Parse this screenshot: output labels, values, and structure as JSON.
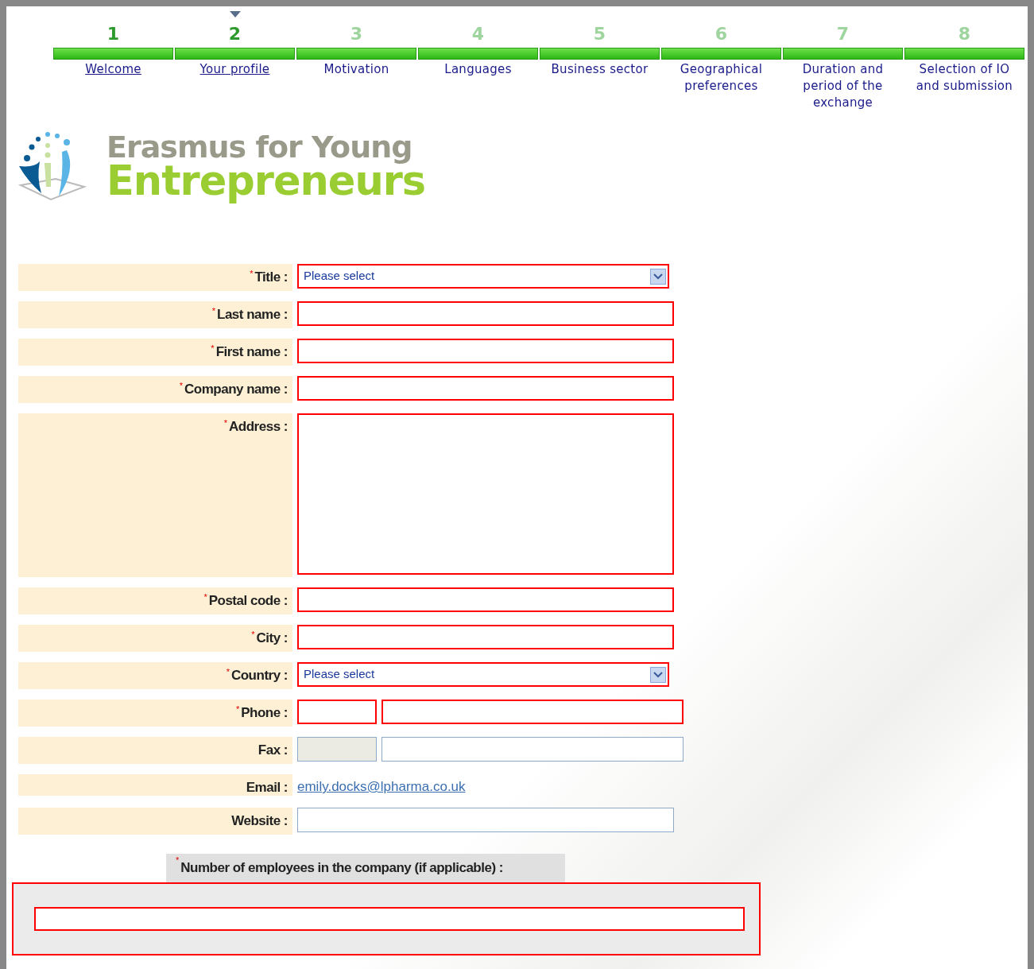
{
  "steps": [
    {
      "number": "1",
      "label": "Welcome",
      "visited": true,
      "selected": false,
      "level": 1
    },
    {
      "number": "2",
      "label": "Your profile",
      "visited": true,
      "selected": true,
      "level": 1
    },
    {
      "number": "3",
      "label": "Motivation",
      "visited": false,
      "selected": false,
      "level": 1
    },
    {
      "number": "4",
      "label": "Languages",
      "visited": false,
      "selected": false,
      "level": 1
    },
    {
      "number": "5",
      "label": "Business sector",
      "visited": false,
      "selected": false,
      "level": 1
    },
    {
      "number": "6",
      "label": "Geographical preferences",
      "visited": false,
      "selected": false,
      "level": 1
    },
    {
      "number": "7",
      "label": "Duration and period of the exchange",
      "visited": false,
      "selected": false,
      "level": 1
    },
    {
      "number": "8",
      "label": "Selection of IO and submission",
      "visited": false,
      "selected": false,
      "level": 1
    }
  ],
  "logo": {
    "line1": "Erasmus for Young",
    "line2": "Entrepreneurs"
  },
  "fields": [
    {
      "kind": "select",
      "marker": "*",
      "label": "Title :",
      "required": true,
      "placeholder": "Please select"
    },
    {
      "kind": "text",
      "marker": "*",
      "label": "Last name :",
      "required": true
    },
    {
      "kind": "text",
      "marker": "*",
      "label": "First name :",
      "required": true
    },
    {
      "kind": "text",
      "marker": "*",
      "label": "Company name :",
      "required": true
    },
    {
      "kind": "textarea",
      "marker": "*",
      "label": "Address :",
      "required": true
    },
    {
      "kind": "text",
      "marker": "*",
      "label": "Postal code :",
      "required": true
    },
    {
      "kind": "text",
      "marker": "*",
      "label": "City :",
      "required": true
    },
    {
      "kind": "select",
      "marker": "*",
      "label": "Country :",
      "required": true,
      "placeholder": "Please select"
    },
    {
      "kind": "split",
      "marker": "*",
      "label": "Phone :",
      "required": true,
      "disabled": false
    },
    {
      "kind": "split",
      "label": "Fax :",
      "required": false,
      "disabled": true
    },
    {
      "kind": "link",
      "label": "Email :",
      "value": "emily.docks@lpharma.co.uk"
    },
    {
      "kind": "text",
      "label": "Website :",
      "required": false
    }
  ],
  "employees": {
    "marker": "*",
    "label": "Number of employees in the company (if applicable) :",
    "required": true
  }
}
